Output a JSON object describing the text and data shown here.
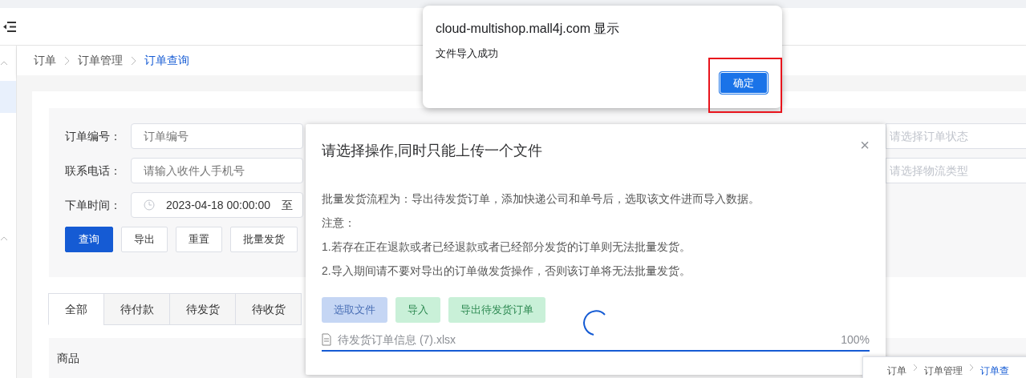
{
  "sidebar": {
    "items": [
      {
        "kind": "group",
        "expanded": true
      },
      {
        "kind": "item",
        "selected": true
      },
      {
        "kind": "group",
        "expanded": true
      }
    ]
  },
  "breadcrumb": [
    {
      "label": "订单",
      "current": false
    },
    {
      "label": "订单管理",
      "current": false
    },
    {
      "label": "订单查询",
      "current": true
    }
  ],
  "filters": [
    {
      "kind": "text",
      "label": "订单编号：",
      "placeholder": "订单编号"
    },
    {
      "kind": "text",
      "label": "联系电话：",
      "placeholder": "请输入收件人手机号"
    },
    {
      "kind": "date",
      "label": "下单时间：",
      "value": "2023-04-18 00:00:00",
      "separator": "至"
    }
  ],
  "right_filters": [
    {
      "placeholder": "请选择订单状态"
    },
    {
      "placeholder": "请选择物流类型"
    }
  ],
  "buttons": [
    {
      "label": "查询",
      "primary": true
    },
    {
      "label": "导出",
      "primary": false
    },
    {
      "label": "重置",
      "primary": false
    },
    {
      "label": "批量发货",
      "primary": false
    }
  ],
  "tabs": [
    {
      "label": "全部",
      "selected": true
    },
    {
      "label": "待付款",
      "selected": false
    },
    {
      "label": "待发货",
      "selected": false
    },
    {
      "label": "待收货",
      "selected": false
    }
  ],
  "table": {
    "columns": [
      "商品"
    ]
  },
  "dialog": {
    "title": "请选择操作,同时只能上传一个文件",
    "close": "×",
    "loading": true,
    "lines": [
      "批量发货流程为：导出待发货订单，添加快递公司和单号后，选取该文件进而导入数据。",
      "注意：",
      "1.若存在正在退款或者已经退款或者已经部分发货的订单则无法批量发货。",
      "2.导入期间请不要对导出的订单做发货操作，否则该订单将无法批量发货。"
    ],
    "actions": [
      {
        "kind": "primary",
        "label": "选取文件"
      },
      {
        "kind": "success",
        "label": "导入"
      },
      {
        "kind": "success",
        "label": "导出待发货订单"
      }
    ],
    "file": {
      "name": "待发货订单信息 (7).xlsx",
      "reading": "100%",
      "level": 1
    }
  },
  "alert": {
    "title": "cloud-multishop.mall4j.com 显示",
    "message": "文件导入成功",
    "button": {
      "label": "确定",
      "highlighted": true
    }
  },
  "peek_window": {
    "breadcrumb": [
      "订单",
      "订单管理",
      "订单查"
    ]
  }
}
